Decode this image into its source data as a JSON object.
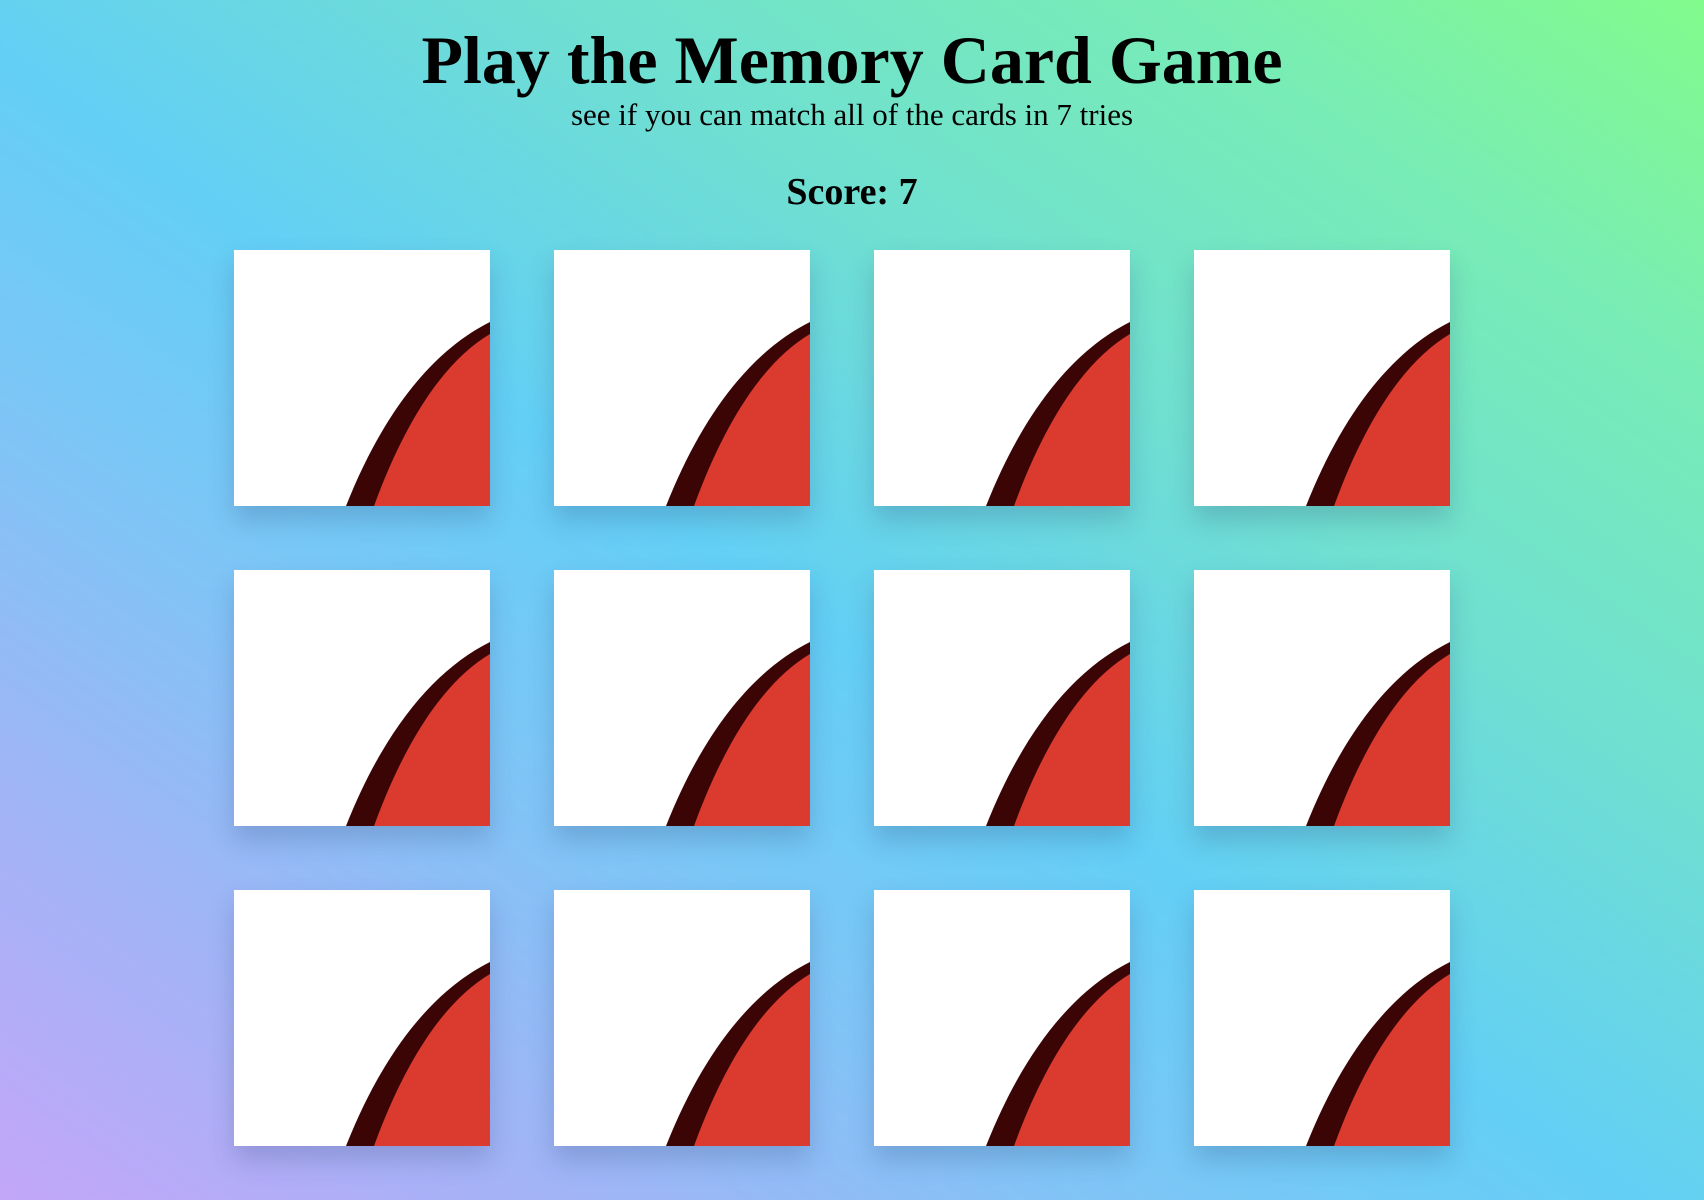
{
  "header": {
    "title": "Play the Memory Card Game",
    "subtitle": "see if you can match all of the cards in 7 tries"
  },
  "score": {
    "text": "Score: 7",
    "value": 7
  },
  "board": {
    "rows": 3,
    "columns": 4,
    "cards": [
      {
        "state": "face-down",
        "back_icon": "pokeball-back-icon"
      },
      {
        "state": "face-down",
        "back_icon": "pokeball-back-icon"
      },
      {
        "state": "face-down",
        "back_icon": "pokeball-back-icon"
      },
      {
        "state": "face-down",
        "back_icon": "pokeball-back-icon"
      },
      {
        "state": "face-down",
        "back_icon": "pokeball-back-icon"
      },
      {
        "state": "face-down",
        "back_icon": "pokeball-back-icon"
      },
      {
        "state": "face-down",
        "back_icon": "pokeball-back-icon"
      },
      {
        "state": "face-down",
        "back_icon": "pokeball-back-icon"
      },
      {
        "state": "face-down",
        "back_icon": "pokeball-back-icon"
      },
      {
        "state": "face-down",
        "back_icon": "pokeball-back-icon"
      },
      {
        "state": "face-down",
        "back_icon": "pokeball-back-icon"
      },
      {
        "state": "face-down",
        "back_icon": "pokeball-back-icon"
      }
    ]
  },
  "colors": {
    "card_face": "#ffffff",
    "back_red": "#db3a2e",
    "back_edge": "#3b0505",
    "background_start": "#c3a6f8",
    "background_mid": "#63cff5",
    "background_end": "#82fb8c"
  }
}
